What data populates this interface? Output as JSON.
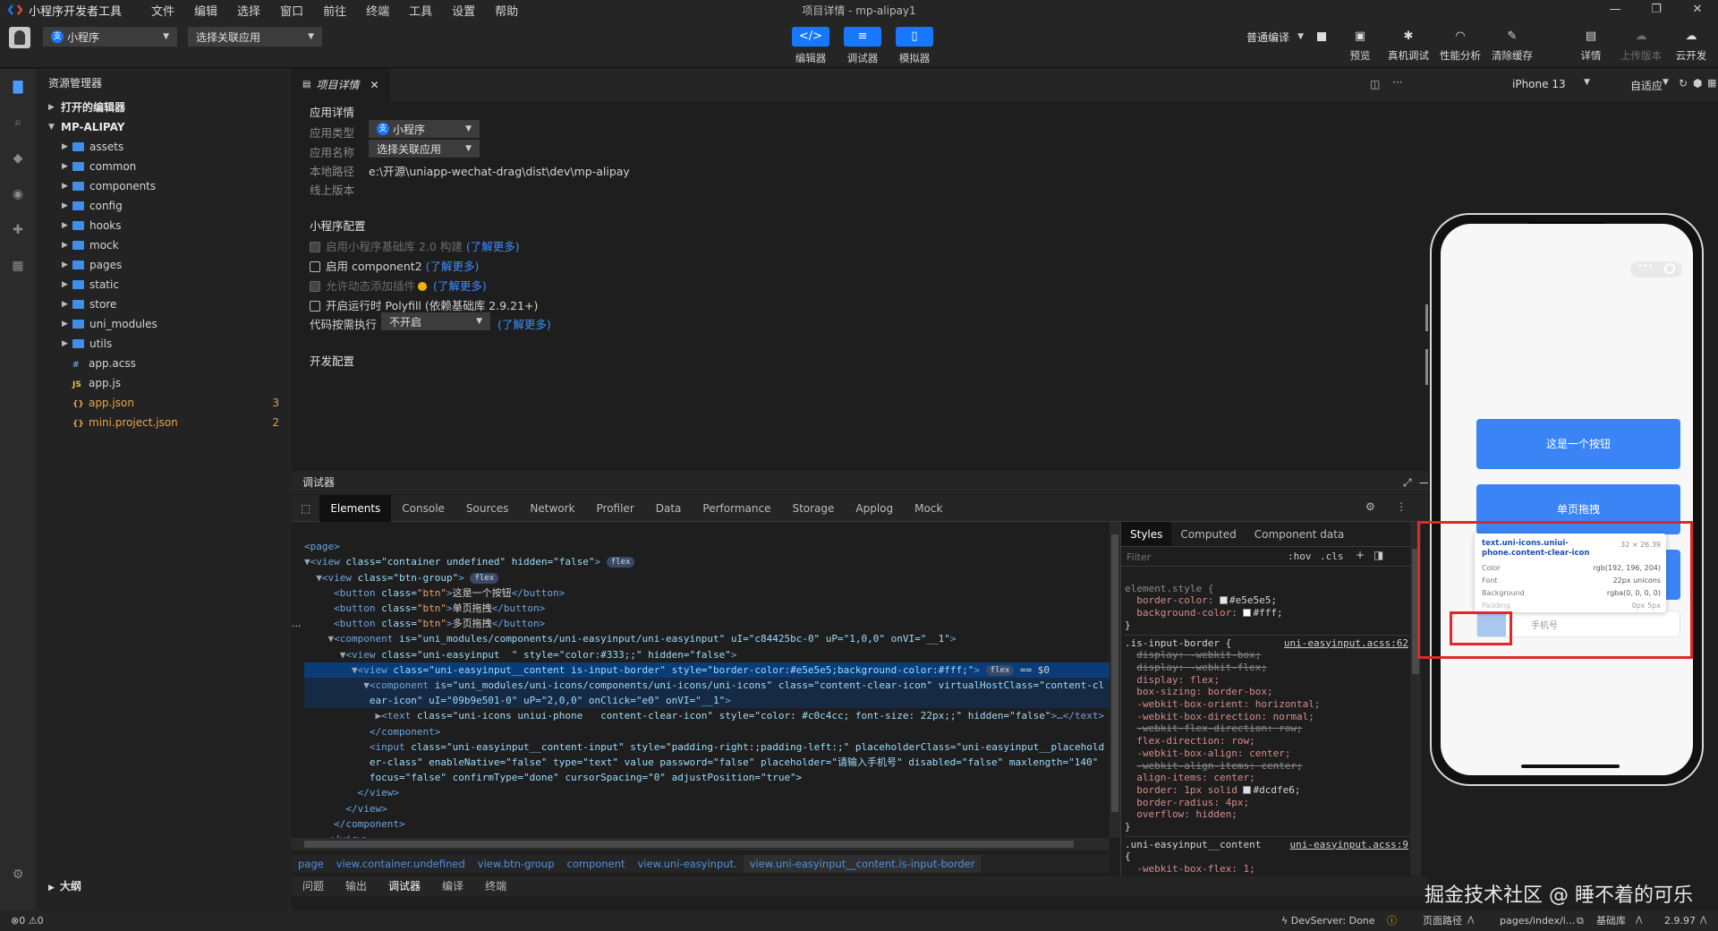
{
  "app": {
    "title": "小程序开发者工具",
    "window_title": "项目详情 - mp-alipay1",
    "menu": [
      "文件",
      "编辑",
      "选择",
      "窗口",
      "前往",
      "终端",
      "工具",
      "设置",
      "帮助"
    ]
  },
  "toolbar": {
    "project_type": "小程序",
    "related_app": "选择关联应用",
    "modes": [
      {
        "label": "编辑器",
        "icon": "</>"
      },
      {
        "label": "调试器",
        "icon": "≡"
      },
      {
        "label": "模拟器",
        "icon": "▯"
      }
    ],
    "compile_mode": "普通编译",
    "tools": [
      "预览",
      "真机调试",
      "性能分析",
      "清除缓存",
      "详情",
      "上传版本",
      "云开发"
    ]
  },
  "explorer": {
    "title": "资源管理器",
    "open_editors": "打开的编辑器",
    "project": "MP-ALIPAY",
    "folders": [
      "assets",
      "common",
      "components",
      "config",
      "hooks",
      "mock",
      "pages",
      "static",
      "store",
      "uni_modules",
      "utils"
    ],
    "files": [
      {
        "name": "app.acss",
        "icon": "#",
        "count": ""
      },
      {
        "name": "app.js",
        "icon": "JS",
        "count": ""
      },
      {
        "name": "app.json",
        "icon": "{}",
        "count": "3"
      },
      {
        "name": "mini.project.json",
        "icon": "{}",
        "count": "2"
      }
    ],
    "outline": "大纲"
  },
  "editor": {
    "tab": "项目详情",
    "app_detail": {
      "title": "应用详情",
      "type_label": "应用类型",
      "type_value": "小程序",
      "name_label": "应用名称",
      "name_value": "选择关联应用",
      "path_label": "本地路径",
      "path_value": "e:\\开源\\uniapp-wechat-drag\\dist\\dev\\mp-alipay",
      "online_label": "线上版本"
    },
    "mini_config": {
      "title": "小程序配置",
      "opt1": "启用小程序基础库 2.0 构建",
      "opt2": "启用 component2",
      "opt3": "允许动态添加插件",
      "opt4": "开启运行时 Polyfill (依赖基础库 2.9.21+)",
      "code_exec_label": "代码按需执行",
      "code_exec_value": "不开启",
      "learn_more": "(了解更多)"
    },
    "dev_config": {
      "title": "开发配置"
    }
  },
  "debugger": {
    "title": "调试器",
    "tabs": [
      "Elements",
      "Console",
      "Sources",
      "Network",
      "Profiler",
      "Data",
      "Performance",
      "Storage",
      "Applog",
      "Mock"
    ],
    "flex_badge": "flex",
    "sel_suffix": "== $0",
    "code": {
      "l1": "<page>",
      "l2_tag": "view",
      "l2_attrs": " class=\"container undefined\" hidden=\"false\"",
      "l3_attrs": " class=\"btn-group\"",
      "btn1": "这是一个按钮",
      "btn2": "单页拖拽",
      "btn3": "多页拖拽",
      "comp1": " is=\"uni_modules/components/uni-easyinput/uni-easyinput\" uI=\"c84425bc-0\" uP=\"1,0,0\" onVI=\"__1\"",
      "easy1": " class=\"uni-easyinput  \" style=\"color:#333;;\" hidden=\"false\"",
      "content": " class=\"uni-easyinput__content is-input-border\" style=\"border-color:#e5e5e5;background-color:#fff;\"",
      "comp2a": " is=\"uni_modules/uni-icons/components/uni-icons/uni-icons\" class=\"content-clear-icon\" virtualHostClass=\"content-cl",
      "comp2b": "ear-icon\" uI=\"09b9e501-0\" uP=\"2,0,0\" onClick=\"e0\" onVI=\"__1\"",
      "text1": " class=\"uni-icons uniui-phone   content-clear-icon\" style=\"color: #c0c4cc; font-size: 22px;;\" hidden=\"false\"",
      "input_a": " class=\"uni-easyinput__content-input\" style=\"padding-right:;padding-left:;\" placeholderClass=\"uni-easyinput__placehold",
      "input_b": "er-class\" enableNative=\"false\" type=\"text\" value password=\"false\" placeholder=\"请输入手机号\" disabled=\"false\" maxlength=\"140\"",
      "input_c": "focus=\"false\" confirmType=\"done\" cursorSpacing=\"0\" adjustPosition=\"true\">"
    },
    "breadcrumbs": [
      "page",
      "view.container.undefined",
      "view.btn-group",
      "component",
      "view.uni-easyinput.",
      "view.uni-easyinput__content.is-input-border"
    ],
    "bottom_tabs": [
      "问题",
      "输出",
      "调试器",
      "编译",
      "终端"
    ]
  },
  "styles": {
    "tabs": [
      "Styles",
      "Computed",
      "Component data"
    ],
    "filter_placeholder": "Filter",
    "hov": ":hov",
    "cls": ".cls",
    "rule0": "element.style {",
    "bc": "border-color: ",
    "bc_v": "#e5e5e5;",
    "bg": "background-color: ",
    "bg_v": "#fff;",
    "rule1": ".is-input-border {",
    "rule1_src": "uni-easyinput.acss:62",
    "props1": [
      {
        "t": "display: -webkit-box;",
        "s": true
      },
      {
        "t": "display: -webkit-flex;",
        "s": true
      },
      {
        "t": "display: flex;",
        "s": false
      },
      {
        "t": "box-sizing: border-box;",
        "s": false
      },
      {
        "t": "-webkit-box-orient: horizontal;",
        "s": false
      },
      {
        "t": "-webkit-box-direction: normal;",
        "s": false
      },
      {
        "t": "-webkit-flex-direction: row;",
        "s": true
      },
      {
        "t": "flex-direction: row;",
        "s": false
      },
      {
        "t": "-webkit-box-align: center;",
        "s": false
      },
      {
        "t": "-webkit-align-items: center;",
        "s": true
      },
      {
        "t": "align-items: center;",
        "s": false
      }
    ],
    "border": "border: 1px solid ",
    "border_v": "#dcdfe6;",
    "radius": "border-radius: 4px;",
    "overflow": "overflow: hidden;",
    "rule2": ".uni-easyinput__content",
    "rule2_src": "uni-easyinput.acss:9",
    "props2": "-webkit-box-flex: 1;"
  },
  "simulator": {
    "device": "iPhone 13",
    "fit": "自适应",
    "btn1": "这是一个按钮",
    "btn2": "单页拖拽",
    "tooltip": {
      "selector": "text.uni-icons.uniui-phone.content-clear-icon",
      "size": "32 × 26.39",
      "color_label": "Color",
      "color_value": "rgb(192, 196, 204)",
      "font_label": "Font",
      "font_value": "22px unicons",
      "bg_label": "Background",
      "bg_value": "rgba(0, 0, 0, 0)",
      "pad_label": "Padding",
      "pad_value": "0px 5px"
    },
    "input_placeholder": "手机号"
  },
  "statusbar": {
    "errors": "0",
    "warnings": "0",
    "devserver": "DevServer: Done",
    "page_path_label": "页面路径",
    "page_path": "pages/index/i...",
    "lib_label": "基础库",
    "lib_version": "2.9.97"
  },
  "watermark": "掘金技术社区 @ 睡不着的可乐",
  "colors": {
    "accent": "#1677ff",
    "highlight_box": "#e02828",
    "phone_button": "#3a84f5"
  }
}
